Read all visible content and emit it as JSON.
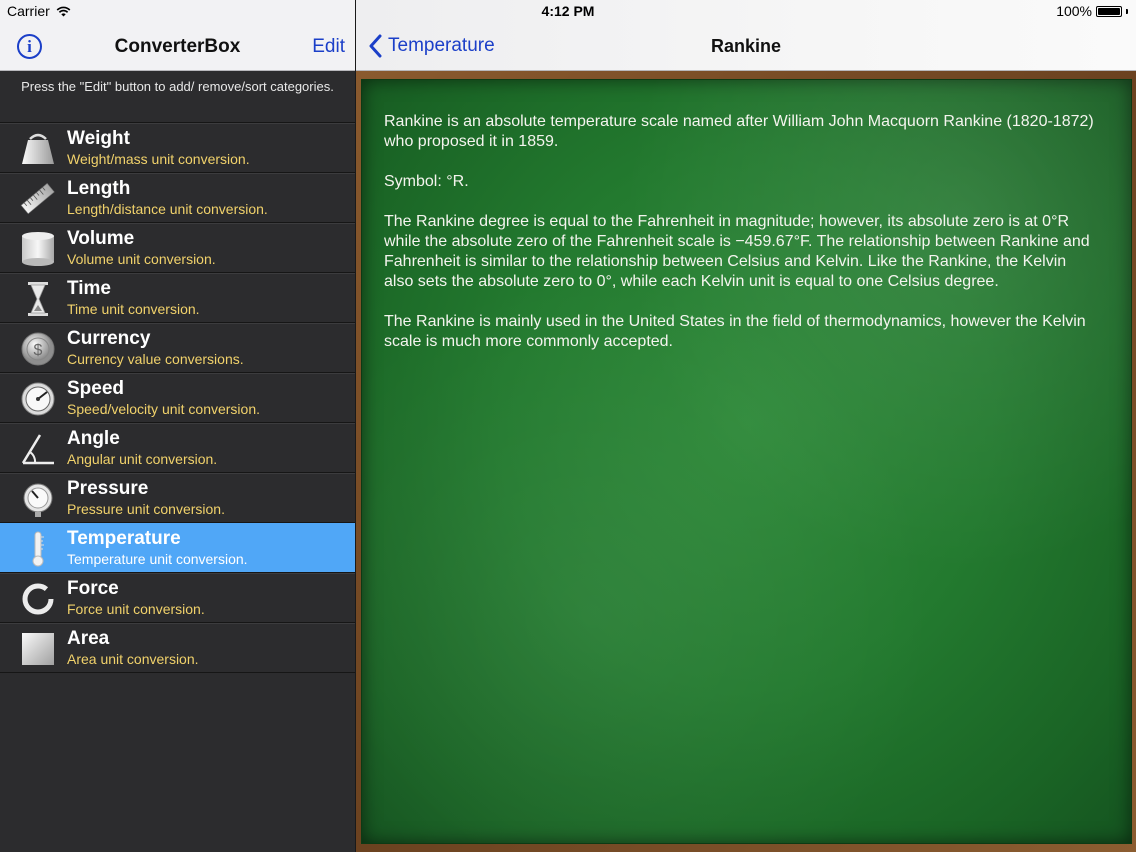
{
  "status_bar": {
    "carrier": "Carrier",
    "time": "4:12 PM",
    "battery": "100%",
    "battery_level": 1.0
  },
  "master": {
    "title": "ConverterBox",
    "edit_label": "Edit",
    "info_glyph": "i",
    "hint": "Press the \"Edit\" button to add/ remove/sort categories.",
    "categories": [
      {
        "title": "Weight",
        "subtitle": "Weight/mass unit conversion.",
        "icon": "weight-icon"
      },
      {
        "title": "Length",
        "subtitle": "Length/distance unit conversion.",
        "icon": "ruler-icon"
      },
      {
        "title": "Volume",
        "subtitle": "Volume unit conversion.",
        "icon": "cylinder-icon"
      },
      {
        "title": "Time",
        "subtitle": "Time unit conversion.",
        "icon": "hourglass-icon"
      },
      {
        "title": "Currency",
        "subtitle": "Currency value conversions.",
        "icon": "coin-icon"
      },
      {
        "title": "Speed",
        "subtitle": "Speed/velocity unit conversion.",
        "icon": "speedometer-icon"
      },
      {
        "title": "Angle",
        "subtitle": "Angular unit conversion.",
        "icon": "angle-icon"
      },
      {
        "title": "Pressure",
        "subtitle": "Pressure unit conversion.",
        "icon": "pressure-gauge-icon"
      },
      {
        "title": "Temperature",
        "subtitle": "Temperature unit conversion.",
        "icon": "thermometer-icon"
      },
      {
        "title": "Force",
        "subtitle": "Force unit conversion.",
        "icon": "force-ring-icon"
      },
      {
        "title": "Area",
        "subtitle": "Area unit conversion.",
        "icon": "square-icon"
      }
    ],
    "selected_index": 8
  },
  "detail": {
    "back_label": "Temperature",
    "title": "Rankine",
    "paragraphs": [
      "Rankine is an absolute temperature scale named after William John Macquorn Rankine (1820-1872) who proposed it in 1859.",
      "Symbol: °R.",
      "The Rankine degree is equal to the Fahrenheit in magnitude; however, its absolute zero is at 0°R while the absolute zero of the Fahrenheit scale is −459.67°F. The relationship between Rankine and Fahrenheit is similar to the relationship between Celsius and Kelvin. Like the Rankine, the Kelvin also sets the absolute zero to 0°, while each Kelvin unit is equal to one Celsius degree.",
      "The Rankine is mainly used in the United States in the field of thermodynamics, however the Kelvin scale is much more commonly accepted."
    ]
  },
  "colors": {
    "accent": "#1b3fc8",
    "selection": "#50a7f7",
    "subtitle": "#f1d26b",
    "board": "#237a2f"
  }
}
